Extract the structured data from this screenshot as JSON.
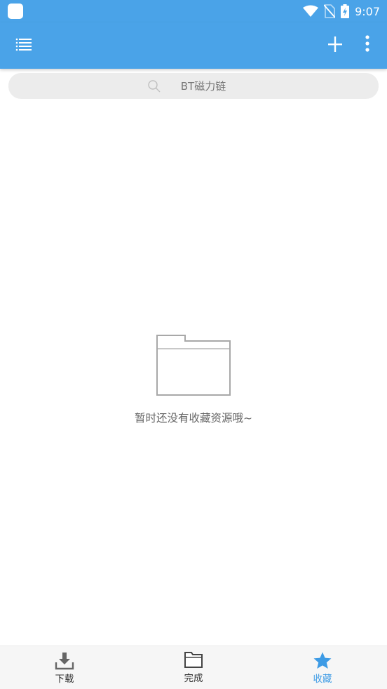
{
  "status_bar": {
    "time": "9:07",
    "icons": [
      "app-icon",
      "wifi-icon",
      "no-sim-icon",
      "battery-charging-icon"
    ]
  },
  "app_bar": {
    "icons": [
      "list-menu-icon",
      "plus-icon",
      "more-vert-icon"
    ]
  },
  "search": {
    "placeholder": "BT磁力链",
    "icon": "search-icon"
  },
  "empty_state": {
    "icon": "empty-folder-icon",
    "message": "暂时还没有收藏资源哦~"
  },
  "bottom_nav": {
    "items": [
      {
        "label": "下载",
        "icon": "download-icon",
        "active": false
      },
      {
        "label": "完成",
        "icon": "folder-icon",
        "active": false
      },
      {
        "label": "收藏",
        "icon": "star-icon",
        "active": true
      }
    ]
  },
  "colors": {
    "primary": "#4aa3e8",
    "active_tab": "#3d9be5",
    "search_bg": "#ececec",
    "bottom_nav_bg": "#f6f6f6"
  }
}
